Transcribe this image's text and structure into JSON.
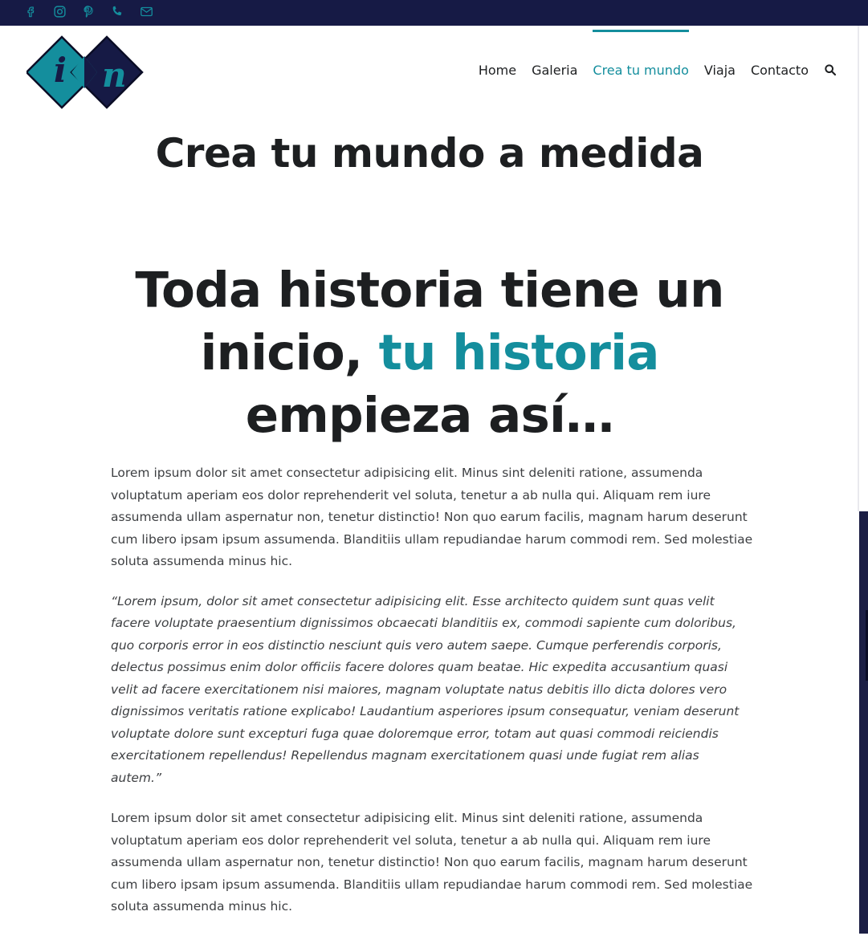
{
  "topbar": {
    "social_icons": [
      "facebook-icon",
      "instagram-icon",
      "pinterest-icon",
      "phone-icon",
      "email-icon"
    ],
    "background": "#161a45",
    "icon_color": "#148e9d"
  },
  "logo": {
    "letters": [
      "i",
      "n"
    ],
    "colors": {
      "teal": "#148e9d",
      "navy": "#161a45"
    }
  },
  "nav": {
    "items": [
      {
        "label": "Home",
        "active": false
      },
      {
        "label": "Galeria",
        "active": false
      },
      {
        "label": "Crea tu mundo",
        "active": true
      },
      {
        "label": "Viaja",
        "active": false
      },
      {
        "label": "Contacto",
        "active": false
      }
    ],
    "search_icon": "search-icon",
    "active_color": "#148e9d"
  },
  "page": {
    "title": "Crea tu mundo a medida",
    "hero_before": "Toda historia tiene un inicio, ",
    "hero_accent": "tu historia",
    "hero_after": " empieza así…",
    "paragraph_1": "Lorem ipsum dolor sit amet consectetur adipisicing elit. Minus sint deleniti ratione, assumenda voluptatum aperiam eos dolor reprehenderit vel soluta, tenetur a ab nulla qui. Aliquam rem iure assumenda ullam aspernatur non, tenetur distinctio! Non quo earum facilis, magnam harum deserunt cum libero ipsam ipsum assumenda. Blanditiis ullam repudiandae harum commodi rem. Sed molestiae soluta assumenda minus hic.",
    "quote": "“Lorem ipsum, dolor sit amet consectetur adipisicing elit. Esse architecto quidem sunt quas velit facere voluptate praesentium dignissimos obcaecati blanditiis ex, commodi sapiente cum doloribus, quo corporis error in eos distinctio nesciunt quis vero autem saepe. Cumque perferendis corporis, delectus possimus enim dolor officiis facere dolores quam beatae. Hic expedita accusantium quasi velit ad facere exercitationem nisi maiores, magnam voluptate natus debitis illo dicta dolores vero dignissimos veritatis ratione explicabo! Laudantium asperiores ipsum consequatur, veniam deserunt voluptate dolore sunt excepturi fuga quae doloremque error, totam aut quasi commodi reiciendis exercitationem repellendus! Repellendus magnam exercitationem quasi unde fugiat rem alias autem.”",
    "paragraph_2": "Lorem ipsum dolor sit amet consectetur adipisicing elit. Minus sint deleniti ratione, assumenda voluptatum aperiam eos dolor reprehenderit vel soluta, tenetur a ab nulla qui. Aliquam rem iure assumenda ullam aspernatur non, tenetur distinctio! Non quo earum facilis, magnam harum deserunt cum libero ipsam ipsum assumenda. Blanditiis ullam repudiandae harum commodi rem. Sed molestiae soluta assumenda minus hic."
  }
}
